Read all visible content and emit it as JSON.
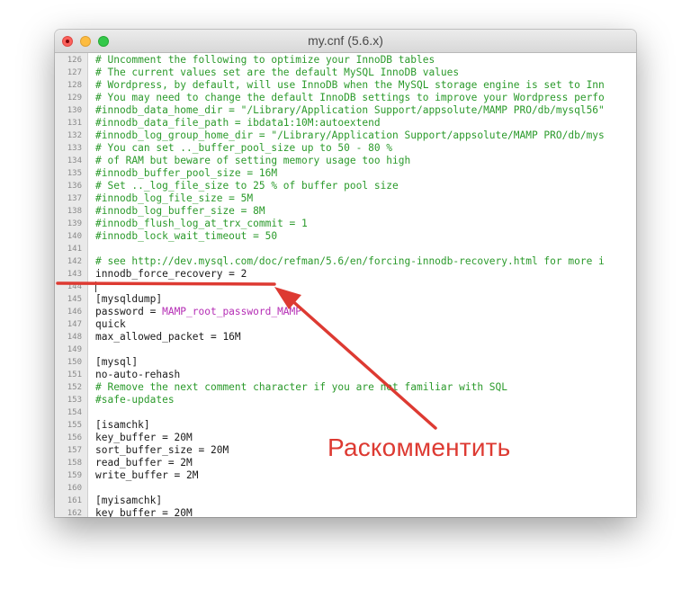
{
  "window": {
    "title": "my.cnf (5.6.x)"
  },
  "colors": {
    "comment": "#2b9a2b",
    "text": "#1a1a1a",
    "string_highlight": "#b52eb5",
    "annotation": "#dd3a32"
  },
  "editor": {
    "lines": [
      {
        "num": "126",
        "segments": [
          {
            "t": "# Uncomment the following to optimize your InnoDB tables",
            "s": "comment"
          }
        ]
      },
      {
        "num": "127",
        "segments": [
          {
            "t": "# The current values set are the default MySQL InnoDB values",
            "s": "comment"
          }
        ]
      },
      {
        "num": "128",
        "segments": [
          {
            "t": "# Wordpress, by default, will use InnoDB when the MySQL storage engine is set to Inn",
            "s": "comment"
          }
        ]
      },
      {
        "num": "129",
        "segments": [
          {
            "t": "# You may need to change the default InnoDB settings to improve your Wordpress perfo",
            "s": "comment"
          }
        ]
      },
      {
        "num": "130",
        "segments": [
          {
            "t": "#innodb_data_home_dir = \"/Library/Application Support/appsolute/MAMP PRO/db/mysql56\"",
            "s": "comment"
          }
        ]
      },
      {
        "num": "131",
        "segments": [
          {
            "t": "#innodb_data_file_path = ibdata1:10M:autoextend",
            "s": "comment"
          }
        ]
      },
      {
        "num": "132",
        "segments": [
          {
            "t": "#innodb_log_group_home_dir = \"/Library/Application Support/appsolute/MAMP PRO/db/mys",
            "s": "comment"
          }
        ]
      },
      {
        "num": "133",
        "segments": [
          {
            "t": "# You can set .._buffer_pool_size up to 50 - 80 %",
            "s": "comment"
          }
        ]
      },
      {
        "num": "134",
        "segments": [
          {
            "t": "# of RAM but beware of setting memory usage too high",
            "s": "comment"
          }
        ]
      },
      {
        "num": "135",
        "segments": [
          {
            "t": "#innodb_buffer_pool_size = 16M",
            "s": "comment"
          }
        ]
      },
      {
        "num": "136",
        "segments": [
          {
            "t": "# Set .._log_file_size to 25 % of buffer pool size",
            "s": "comment"
          }
        ]
      },
      {
        "num": "137",
        "segments": [
          {
            "t": "#innodb_log_file_size = 5M",
            "s": "comment"
          }
        ]
      },
      {
        "num": "138",
        "segments": [
          {
            "t": "#innodb_log_buffer_size = 8M",
            "s": "comment"
          }
        ]
      },
      {
        "num": "139",
        "segments": [
          {
            "t": "#innodb_flush_log_at_trx_commit = 1",
            "s": "comment"
          }
        ]
      },
      {
        "num": "140",
        "segments": [
          {
            "t": "#innodb_lock_wait_timeout = 50",
            "s": "comment"
          }
        ]
      },
      {
        "num": "141",
        "segments": []
      },
      {
        "num": "142",
        "segments": [
          {
            "t": "# see http://dev.mysql.com/doc/refman/5.6/en/forcing-innodb-recovery.html for more i",
            "s": "comment"
          }
        ]
      },
      {
        "num": "143",
        "segments": [
          {
            "t": "innodb_force_recovery = 2",
            "s": "plain"
          }
        ]
      },
      {
        "num": "144",
        "segments": [],
        "cursor": true
      },
      {
        "num": "145",
        "segments": [
          {
            "t": "[mysqldump]",
            "s": "plain"
          }
        ]
      },
      {
        "num": "146",
        "segments": [
          {
            "t": "password = ",
            "s": "plain"
          },
          {
            "t": "MAMP_root_password_MAMP",
            "s": "purple"
          }
        ]
      },
      {
        "num": "147",
        "segments": [
          {
            "t": "quick",
            "s": "plain"
          }
        ]
      },
      {
        "num": "148",
        "segments": [
          {
            "t": "max_allowed_packet = 16M",
            "s": "plain"
          }
        ]
      },
      {
        "num": "149",
        "segments": []
      },
      {
        "num": "150",
        "segments": [
          {
            "t": "[mysql]",
            "s": "plain"
          }
        ]
      },
      {
        "num": "151",
        "segments": [
          {
            "t": "no-auto-rehash",
            "s": "plain"
          }
        ]
      },
      {
        "num": "152",
        "segments": [
          {
            "t": "# Remove the next comment character if you are not familiar with SQL",
            "s": "comment"
          }
        ]
      },
      {
        "num": "153",
        "segments": [
          {
            "t": "#safe-updates",
            "s": "comment"
          }
        ]
      },
      {
        "num": "154",
        "segments": []
      },
      {
        "num": "155",
        "segments": [
          {
            "t": "[isamchk]",
            "s": "plain"
          }
        ]
      },
      {
        "num": "156",
        "segments": [
          {
            "t": "key_buffer = 20M",
            "s": "plain"
          }
        ]
      },
      {
        "num": "157",
        "segments": [
          {
            "t": "sort_buffer_size = 20M",
            "s": "plain"
          }
        ]
      },
      {
        "num": "158",
        "segments": [
          {
            "t": "read_buffer = 2M",
            "s": "plain"
          }
        ]
      },
      {
        "num": "159",
        "segments": [
          {
            "t": "write_buffer = 2M",
            "s": "plain"
          }
        ]
      },
      {
        "num": "160",
        "segments": []
      },
      {
        "num": "161",
        "segments": [
          {
            "t": "[myisamchk]",
            "s": "plain"
          }
        ]
      },
      {
        "num": "162",
        "segments": [
          {
            "t": "key_buffer = 20M",
            "s": "plain"
          }
        ]
      }
    ]
  },
  "annotation": {
    "label": "Раскомментить"
  }
}
